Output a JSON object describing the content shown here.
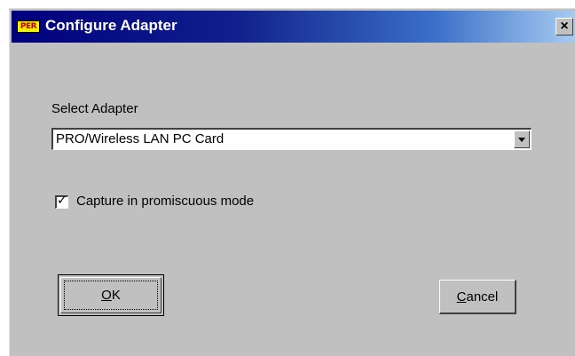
{
  "window": {
    "icon_text": "PER",
    "title": "Configure Adapter",
    "close_glyph": "×",
    "icon": "close-icon"
  },
  "adapter": {
    "label": "Select Adapter",
    "selected": "PRO/Wireless LAN PC Card",
    "dropdown_icon": "chevron-down-icon"
  },
  "promiscuous": {
    "label": "Capture in promiscuous mode",
    "checked": true,
    "check_glyph": "✓"
  },
  "buttons": {
    "ok_label": "OK",
    "ok_mnemonic": "O",
    "ok_rest": "K",
    "cancel_label": "Cancel",
    "cancel_mnemonic": "C",
    "cancel_rest": "ancel"
  },
  "colors": {
    "title_bar_start": "#00007e",
    "title_bar_end": "#a6caf0",
    "dialog_face": "#c0c0c0",
    "icon_badge": "#f0f000"
  }
}
